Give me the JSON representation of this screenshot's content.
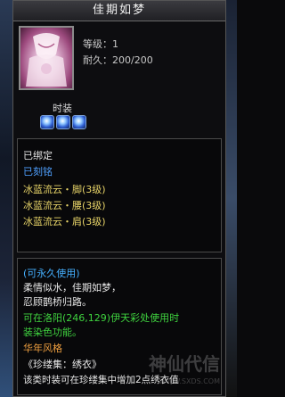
{
  "item": {
    "name": "佳期如梦",
    "level_label": "等级：1",
    "durability_label": "耐久：200/200"
  },
  "section_label": "时装",
  "gem_count": 3,
  "bind": {
    "bound": "已绑定",
    "engraved": "已刻铭",
    "sets": [
      "冰蓝流云・脚(3级)",
      "冰蓝流云・腰(3级)",
      "冰蓝流云・肩(3级)"
    ]
  },
  "desc": {
    "permanent": "(可永久使用)",
    "poem1": "柔情似水，佳期如梦，",
    "poem2": "忍顾鹊桥归路。",
    "dye1": "可在洛阳(246,129)伊天彩处使用时",
    "dye2": "装染色功能。",
    "style": "华年风格",
    "collection": "《珍缕集：绣衣》",
    "bonus": "该类时装可在珍缕集中增加2点绣衣值"
  },
  "watermark": {
    "text": "神仙代信",
    "url": "WWW.SXDS.COM"
  },
  "colors": {
    "bound": "#e6e6e6",
    "engraved": "#4fa0ff",
    "sets": "#e8d468",
    "permanent": "#45b0ff",
    "dye": "#3fd23f",
    "style": "#f0a040"
  }
}
